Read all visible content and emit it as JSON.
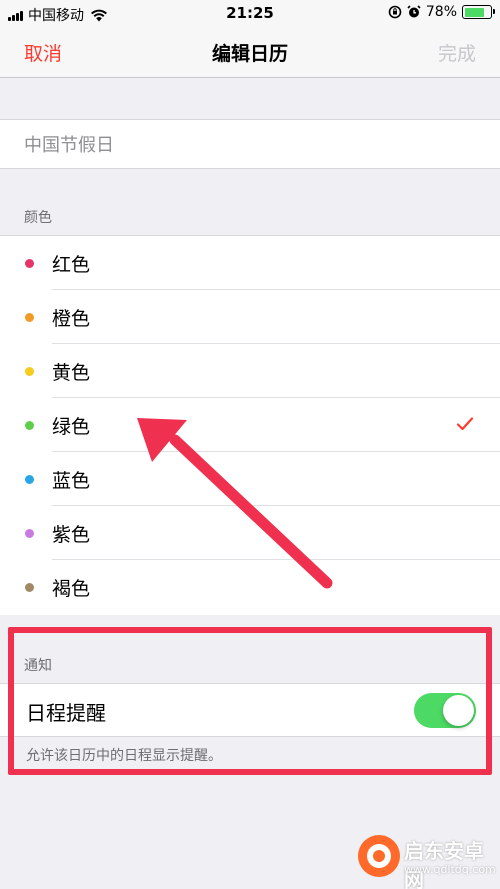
{
  "status_bar": {
    "carrier": "中国移动",
    "time": "21:25",
    "battery": "78%",
    "battery_level": 0.78
  },
  "nav": {
    "cancel_label": "取消",
    "title": "编辑日历",
    "done_label": "完成"
  },
  "calendar_name": {
    "value": "中国节假日"
  },
  "colors_section": {
    "header": "颜色",
    "items": [
      {
        "label": "红色",
        "color": "#e5336b",
        "selected": false
      },
      {
        "label": "橙色",
        "color": "#f09a27",
        "selected": false
      },
      {
        "label": "黄色",
        "color": "#f7cc1d",
        "selected": false
      },
      {
        "label": "绿色",
        "color": "#5fcf4b",
        "selected": true
      },
      {
        "label": "蓝色",
        "color": "#27a6e3",
        "selected": false
      },
      {
        "label": "紫色",
        "color": "#c77be0",
        "selected": false
      },
      {
        "label": "褐色",
        "color": "#a28966",
        "selected": false
      }
    ]
  },
  "notifications": {
    "header": "通知",
    "label": "日程提醒",
    "enabled": true,
    "footer": "允许该日历中的日程显示提醒。"
  },
  "watermark": {
    "name": "启东安卓网",
    "url": "www.qdltdq.com"
  },
  "accent_color": "#ff3b30",
  "toggle_color": "#4cd964",
  "annotation_color": "#f0304f"
}
